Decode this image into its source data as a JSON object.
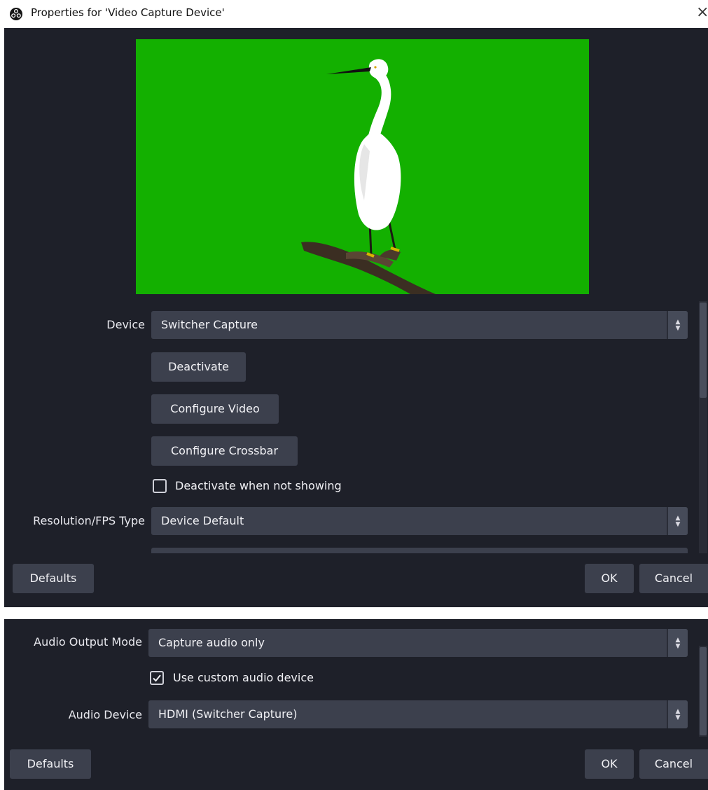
{
  "window": {
    "title": "Properties for 'Video Capture Device'",
    "close_glyph": "×"
  },
  "preview": {
    "background": "#13b000",
    "subject": "egret-on-branch"
  },
  "device": {
    "label": "Device",
    "value": "Switcher Capture"
  },
  "buttons": {
    "deactivate": "Deactivate",
    "configure_video": "Configure Video",
    "configure_crossbar": "Configure Crossbar"
  },
  "deactivate_when_not_showing": {
    "label": "Deactivate when not showing",
    "checked": false
  },
  "resolution_fps": {
    "label": "Resolution/FPS Type",
    "value": "Device Default"
  },
  "footer": {
    "defaults": "Defaults",
    "ok": "OK",
    "cancel": "Cancel"
  },
  "audio_output_mode": {
    "label": "Audio Output Mode",
    "value": "Capture audio only"
  },
  "use_custom_audio_device": {
    "label": "Use custom audio device",
    "checked": true
  },
  "audio_device": {
    "label": "Audio Device",
    "value": "HDMI (Switcher Capture)"
  },
  "colors": {
    "panel": "#1e2029",
    "control": "#3c404d",
    "text": "#f0f0f4",
    "chroma_green": "#13b000"
  }
}
